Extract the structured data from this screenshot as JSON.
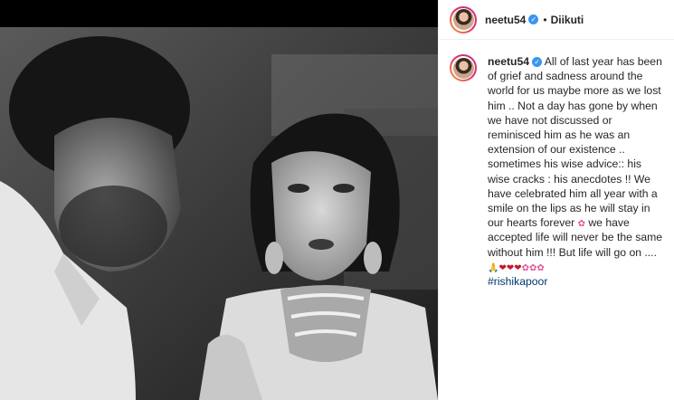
{
  "post": {
    "username": "neetu54",
    "follow_label": "Diikuti",
    "dot": "•",
    "verified_symbol": "✓",
    "caption": {
      "part1": "All of last year has been of grief and sadness around the world for us maybe more as we lost him .. Not a day has gone by when we have not discussed or reminisced him as he was an extension of our existence .. sometimes his wise advice:: his wise cracks : his anecdotes !! We have celebrated him all year with a smile on the lips as he will stay in our hearts forever",
      "emoji1": "✿",
      "part2": "we have accepted life will never be the same without him !!! But life will go on ....",
      "emoji_hands": "🙏",
      "emoji_hearts": "❤❤❤",
      "emoji_flowers": "✿✿✿",
      "hashtag": "#rishikapoor"
    }
  },
  "icons": {
    "verified": "verified-badge-icon",
    "avatar": "profile-avatar"
  }
}
